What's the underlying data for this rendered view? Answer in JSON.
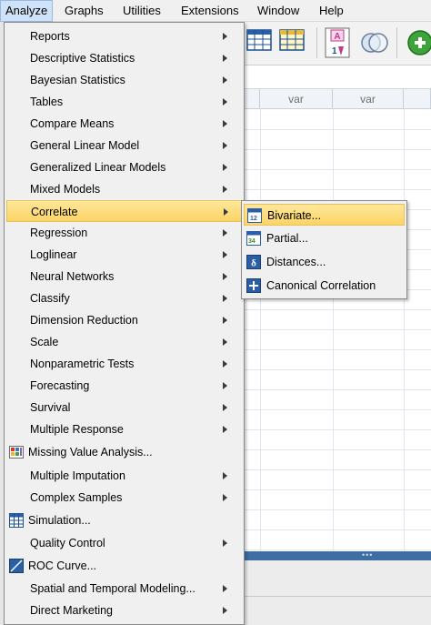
{
  "menubar": {
    "items": [
      {
        "label": "Analyze",
        "active": true
      },
      {
        "label": "Graphs"
      },
      {
        "label": "Utilities"
      },
      {
        "label": "Extensions"
      },
      {
        "label": "Window"
      },
      {
        "label": "Help"
      }
    ]
  },
  "data_view": {
    "column_headers": [
      "var",
      "var"
    ]
  },
  "analyze_menu": {
    "items": [
      {
        "label": "Reports",
        "submenu": true
      },
      {
        "label": "Descriptive Statistics",
        "submenu": true
      },
      {
        "label": "Bayesian Statistics",
        "submenu": true
      },
      {
        "label": "Tables",
        "submenu": true
      },
      {
        "label": "Compare Means",
        "submenu": true
      },
      {
        "label": "General Linear Model",
        "submenu": true
      },
      {
        "label": "Generalized Linear Models",
        "submenu": true
      },
      {
        "label": "Mixed Models",
        "submenu": true
      },
      {
        "label": "Correlate",
        "submenu": true,
        "highlighted": true
      },
      {
        "label": "Regression",
        "submenu": true
      },
      {
        "label": "Loglinear",
        "submenu": true
      },
      {
        "label": "Neural Networks",
        "submenu": true
      },
      {
        "label": "Classify",
        "submenu": true
      },
      {
        "label": "Dimension Reduction",
        "submenu": true
      },
      {
        "label": "Scale",
        "submenu": true
      },
      {
        "label": "Nonparametric Tests",
        "submenu": true
      },
      {
        "label": "Forecasting",
        "submenu": true
      },
      {
        "label": "Survival",
        "submenu": true
      },
      {
        "label": "Multiple Response",
        "submenu": true
      },
      {
        "label": "Missing Value Analysis...",
        "icon": "missing-value-icon"
      },
      {
        "label": "Multiple Imputation",
        "submenu": true
      },
      {
        "label": "Complex Samples",
        "submenu": true
      },
      {
        "label": "Simulation...",
        "icon": "simulation-icon"
      },
      {
        "label": "Quality Control",
        "submenu": true
      },
      {
        "label": "ROC Curve...",
        "icon": "roc-curve-icon"
      },
      {
        "label": "Spatial and Temporal Modeling...",
        "submenu": true
      },
      {
        "label": "Direct Marketing",
        "submenu": true
      }
    ]
  },
  "correlate_submenu": {
    "items": [
      {
        "label": "Bivariate...",
        "icon": "bivariate-icon",
        "highlighted": true
      },
      {
        "label": "Partial...",
        "icon": "partial-icon"
      },
      {
        "label": "Distances...",
        "icon": "distances-icon"
      },
      {
        "label": "Canonical Correlation",
        "icon": "canonical-correlation-icon"
      }
    ]
  },
  "colors": {
    "highlight": "#fcd464",
    "menu_bg": "#f0f0f0",
    "status_band": "#3f6ea3"
  }
}
